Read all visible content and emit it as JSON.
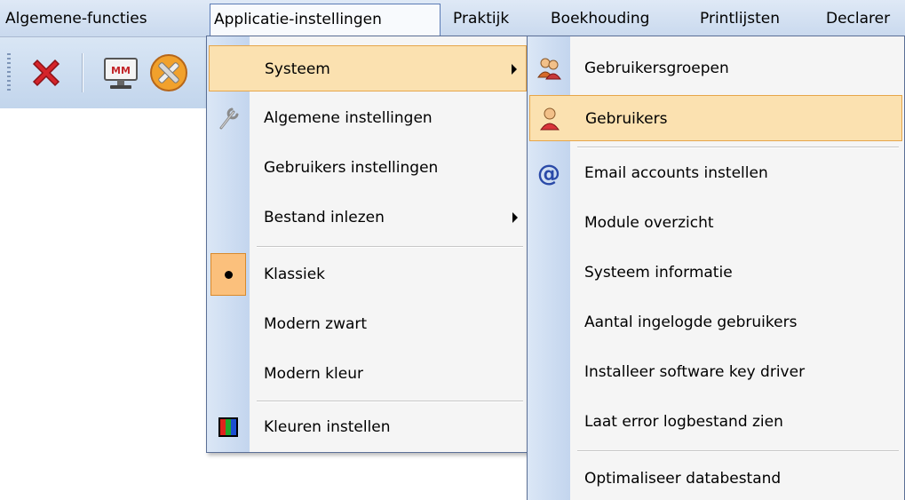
{
  "menubar": {
    "items": [
      {
        "label": "Algemene-functies"
      },
      {
        "label": "Applicatie-instellingen"
      },
      {
        "label": "Praktijk"
      },
      {
        "label": "Boekhouding"
      },
      {
        "label": "Printlijsten"
      },
      {
        "label": "Declarer"
      }
    ]
  },
  "toolbar": {
    "icons": [
      "close-red-x-icon",
      "mm-monitor-icon",
      "tools-icon"
    ]
  },
  "applicatie_menu": {
    "items": [
      {
        "label": "Systeem",
        "icon": "none",
        "submenu": true,
        "highlighted": true
      },
      {
        "label": "Algemene instellingen",
        "icon": "wrench-icon"
      },
      {
        "label": "Gebruikers instellingen"
      },
      {
        "label": "Bestand inlezen",
        "submenu": true
      },
      {
        "label": "Klassiek",
        "checked": true
      },
      {
        "label": "Modern zwart"
      },
      {
        "label": "Modern kleur"
      },
      {
        "label": "Kleuren instellen",
        "icon": "color-bars-icon"
      }
    ]
  },
  "systeem_menu": {
    "items": [
      {
        "label": "Gebruikersgroepen",
        "icon": "user-group-icon"
      },
      {
        "label": "Gebruikers",
        "icon": "user-icon",
        "highlighted": true
      },
      {
        "label": "Email accounts instellen",
        "icon": "at-sign-icon"
      },
      {
        "label": "Module overzicht"
      },
      {
        "label": "Systeem informatie"
      },
      {
        "label": "Aantal ingelogde gebruikers"
      },
      {
        "label": "Installeer software key driver"
      },
      {
        "label": "Laat error logbestand zien"
      },
      {
        "label": "Optimaliseer databestand"
      }
    ]
  },
  "colors": {
    "highlight_bg": "#fbe1b0",
    "highlight_border": "#e6a64a",
    "menubar_bg": "#d4e2f3"
  }
}
